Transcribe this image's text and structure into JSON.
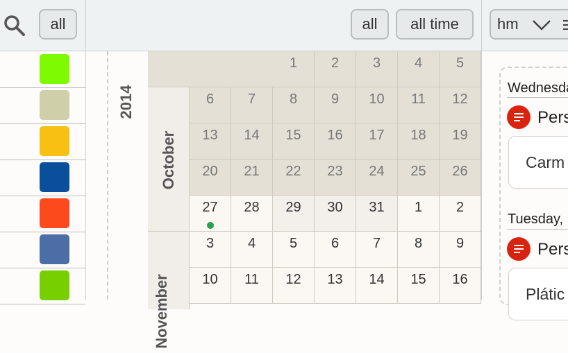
{
  "toolbar": {
    "filter_all_left": "all",
    "filter_all_right": "all",
    "time_range": "all time",
    "format_select": "hm"
  },
  "colors": {
    "swatches": [
      "#7ffb00",
      "#cfd0a9",
      "#f8c013",
      "#0a4f9c",
      "#fd4a1d",
      "#4a6ea5",
      "#77cf00"
    ],
    "past_cell": "#e4e0d6",
    "event_icon": "#d8230f",
    "today_dot": "#27a14a"
  },
  "calendar": {
    "year": "2014",
    "months": [
      "October",
      "November"
    ],
    "weeks": [
      [
        "",
        "",
        "1",
        "2",
        "3",
        "4",
        "5"
      ],
      [
        "6",
        "7",
        "8",
        "9",
        "10",
        "11",
        "12"
      ],
      [
        "13",
        "14",
        "15",
        "16",
        "17",
        "18",
        "19"
      ],
      [
        "20",
        "21",
        "22",
        "23",
        "24",
        "25",
        "26"
      ],
      [
        "27",
        "28",
        "29",
        "30",
        "31",
        "1",
        "2"
      ],
      [
        "3",
        "4",
        "5",
        "6",
        "7",
        "8",
        "9"
      ],
      [
        "10",
        "11",
        "12",
        "13",
        "14",
        "15",
        "16"
      ]
    ],
    "event_day": "27"
  },
  "agenda": {
    "days": [
      {
        "label": "Wednesday",
        "event_title": "Pers",
        "event_detail": "Carm"
      },
      {
        "label": "Tuesday,",
        "event_title": "Pers",
        "event_detail": "Plátic"
      }
    ]
  }
}
